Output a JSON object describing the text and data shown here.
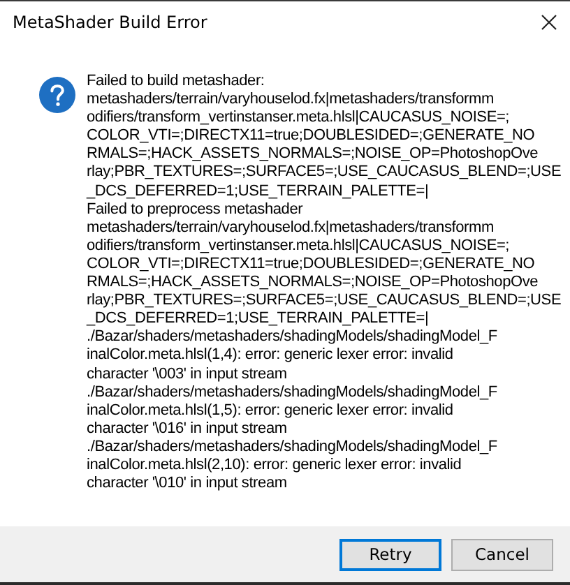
{
  "window": {
    "title": "MetaShader Build Error"
  },
  "message_lines": [
    "Failed to build metashader:",
    "metashaders/terrain/varyhouselod.fx|metashaders/transformm",
    "odifiers/transform_vertinstanser.meta.hlsl|CAUCASUS_NOISE=;",
    "COLOR_VTI=;DIRECTX11=true;DOUBLESIDED=;GENERATE_NO",
    "RMALS=;HACK_ASSETS_NORMALS=;NOISE_OP=PhotoshopOve",
    "rlay;PBR_TEXTURES=;SURFACE5=;USE_CAUCASUS_BLEND=;USE",
    "_DCS_DEFERRED=1;USE_TERRAIN_PALETTE=|",
    "Failed to preprocess metashader",
    "metashaders/terrain/varyhouselod.fx|metashaders/transformm",
    "odifiers/transform_vertinstanser.meta.hlsl|CAUCASUS_NOISE=;",
    "COLOR_VTI=;DIRECTX11=true;DOUBLESIDED=;GENERATE_NO",
    "RMALS=;HACK_ASSETS_NORMALS=;NOISE_OP=PhotoshopOve",
    "rlay;PBR_TEXTURES=;SURFACE5=;USE_CAUCASUS_BLEND=;USE",
    "_DCS_DEFERRED=1;USE_TERRAIN_PALETTE=|",
    "./Bazar/shaders/metashaders/shadingModels/shadingModel_F",
    "inalColor.meta.hlsl(1,4): error: generic lexer error: invalid",
    "character '\\003' in input stream",
    "./Bazar/shaders/metashaders/shadingModels/shadingModel_F",
    "inalColor.meta.hlsl(1,5): error: generic lexer error: invalid",
    "character '\\016' in input stream",
    "./Bazar/shaders/metashaders/shadingModels/shadingModel_F",
    "inalColor.meta.hlsl(2,10): error: generic lexer error: invalid",
    "character '\\010' in input stream"
  ],
  "buttons": [
    {
      "label": "Retry",
      "selected": true
    },
    {
      "label": "Cancel",
      "selected": false
    }
  ]
}
